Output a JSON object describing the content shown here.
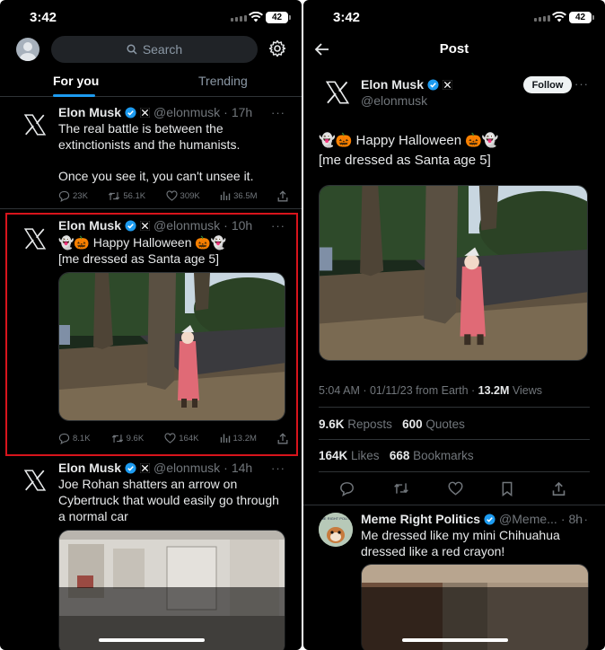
{
  "left": {
    "status": {
      "time": "3:42",
      "battery": "42"
    },
    "search": {
      "placeholder": "Search"
    },
    "tabs": [
      {
        "label": "For you"
      },
      {
        "label": "Trending"
      }
    ],
    "tweets": [
      {
        "name": "Elon Musk",
        "handle": "@elonmusk",
        "time": "17h",
        "lines": [
          "The real battle is between the",
          "extinctionists and the humanists.",
          "",
          "Once you see it, you can't unsee it."
        ],
        "replies": "23K",
        "reposts": "56.1K",
        "likes": "309K",
        "views": "36.5M"
      },
      {
        "name": "Elon Musk",
        "handle": "@elonmusk",
        "time": "10h",
        "lines": [
          "👻🎃 Happy Halloween 🎃👻",
          "[me dressed as Santa age 5]"
        ],
        "replies": "8.1K",
        "reposts": "9.6K",
        "likes": "164K",
        "views": "13.2M"
      },
      {
        "name": "Elon Musk",
        "handle": "@elonmusk",
        "time": "14h",
        "lines": [
          "Joe Rohan shatters an arrow on",
          "Cybertruck that would easily go through",
          "a normal car"
        ]
      }
    ]
  },
  "right": {
    "status": {
      "time": "3:42",
      "battery": "42"
    },
    "header_title": "Post",
    "author": {
      "name": "Elon Musk",
      "handle": "@elonmusk",
      "follow_label": "Follow"
    },
    "lines": [
      "👻🎃 Happy Halloween 🎃👻",
      "[me dressed as Santa age 5]"
    ],
    "meta": {
      "timestamp": "5:04 AM · 01/11/23 from Earth · ",
      "views_count": "13.2M",
      "views_label": " Views"
    },
    "stats": {
      "reposts_count": "9.6K",
      "reposts_label": "Reposts",
      "quotes_count": "600",
      "quotes_label": "Quotes",
      "likes_count": "164K",
      "likes_label": "Likes",
      "bookmarks_count": "668",
      "bookmarks_label": "Bookmarks"
    },
    "reply": {
      "name": "Meme Right Politics",
      "handle": "@Meme...",
      "time": "8h",
      "avatar_text": "MEME RIGHT POLITICS",
      "lines": [
        "Me dressed like my mini Chihuahua",
        "dressed like a red crayon!"
      ]
    }
  },
  "colors": {
    "accent": "#1d9bf0",
    "highlight_box": "#d8141c",
    "background": "#000000"
  }
}
